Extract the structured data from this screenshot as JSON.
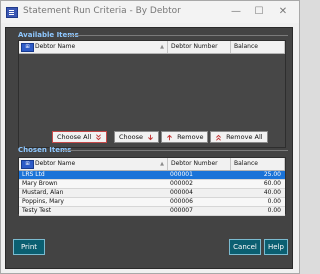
{
  "window": {
    "title": "Statement Run Criteria - By Debtor",
    "minimize_glyph": "—",
    "maximize_glyph": "☐",
    "close_glyph": "✕"
  },
  "available": {
    "section_label": "Available Items",
    "columns": [
      "Debtor Name",
      "Debtor Number",
      "Balance"
    ],
    "rows": []
  },
  "actions": {
    "choose_all": "Choose All",
    "choose": "Choose",
    "remove": "Remove",
    "remove_all": "Remove All"
  },
  "chosen": {
    "section_label": "Chosen Items",
    "columns": [
      "Debtor Name",
      "Debtor Number",
      "Balance"
    ],
    "rows": [
      {
        "name": "LRS Ltd",
        "number": "000001",
        "balance": "25.00"
      },
      {
        "name": "Mary Brown",
        "number": "000002",
        "balance": "60.00"
      },
      {
        "name": "Mustard, Alan",
        "number": "000004",
        "balance": "40.00"
      },
      {
        "name": "Poppins, Mary",
        "number": "000006",
        "balance": "0.00"
      },
      {
        "name": "Testy Test",
        "number": "000007",
        "balance": "0.00"
      }
    ],
    "selected_index": 0
  },
  "footer": {
    "print": "Print",
    "cancel": "Cancel",
    "help": "Help"
  },
  "colors": {
    "selection": "#1a73d8",
    "footer_button": "#0b5f71",
    "section_label": "#8fc8ff"
  }
}
